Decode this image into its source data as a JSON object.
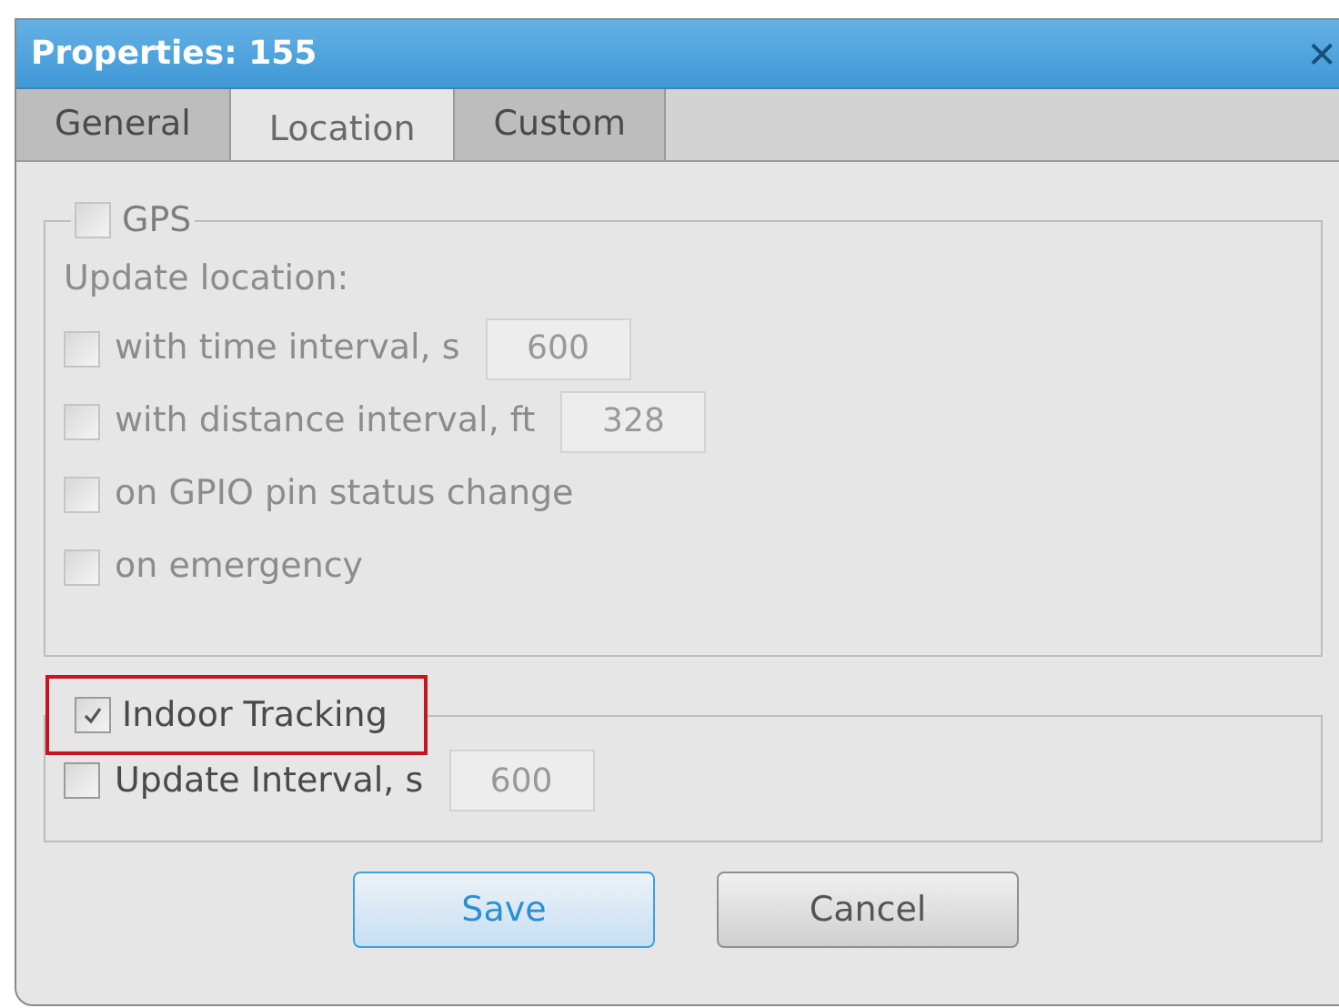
{
  "window": {
    "title": "Properties: 155",
    "close": "✕"
  },
  "tabs": [
    {
      "label": "General",
      "selected": false
    },
    {
      "label": "Location",
      "selected": true
    },
    {
      "label": "Custom",
      "selected": false
    }
  ],
  "gps": {
    "label": "GPS",
    "checked": false,
    "caption": "Update location:",
    "options": [
      {
        "label": "with time interval, s",
        "checked": false,
        "disabled": true,
        "value": "600"
      },
      {
        "label": "with distance interval, ft",
        "checked": false,
        "disabled": true,
        "value": "328"
      },
      {
        "label": "on GPIO pin status change",
        "checked": false,
        "disabled": true
      },
      {
        "label": "on emergency",
        "checked": false,
        "disabled": true
      }
    ]
  },
  "indoor": {
    "label": "Indoor Tracking",
    "checked": true,
    "highlighted": true,
    "options": [
      {
        "label": "Update Interval, s",
        "checked": false,
        "disabled": false,
        "value": "600"
      }
    ]
  },
  "buttons": [
    {
      "label": "Save",
      "kind": "primary"
    },
    {
      "label": "Cancel",
      "kind": "secondary"
    }
  ]
}
